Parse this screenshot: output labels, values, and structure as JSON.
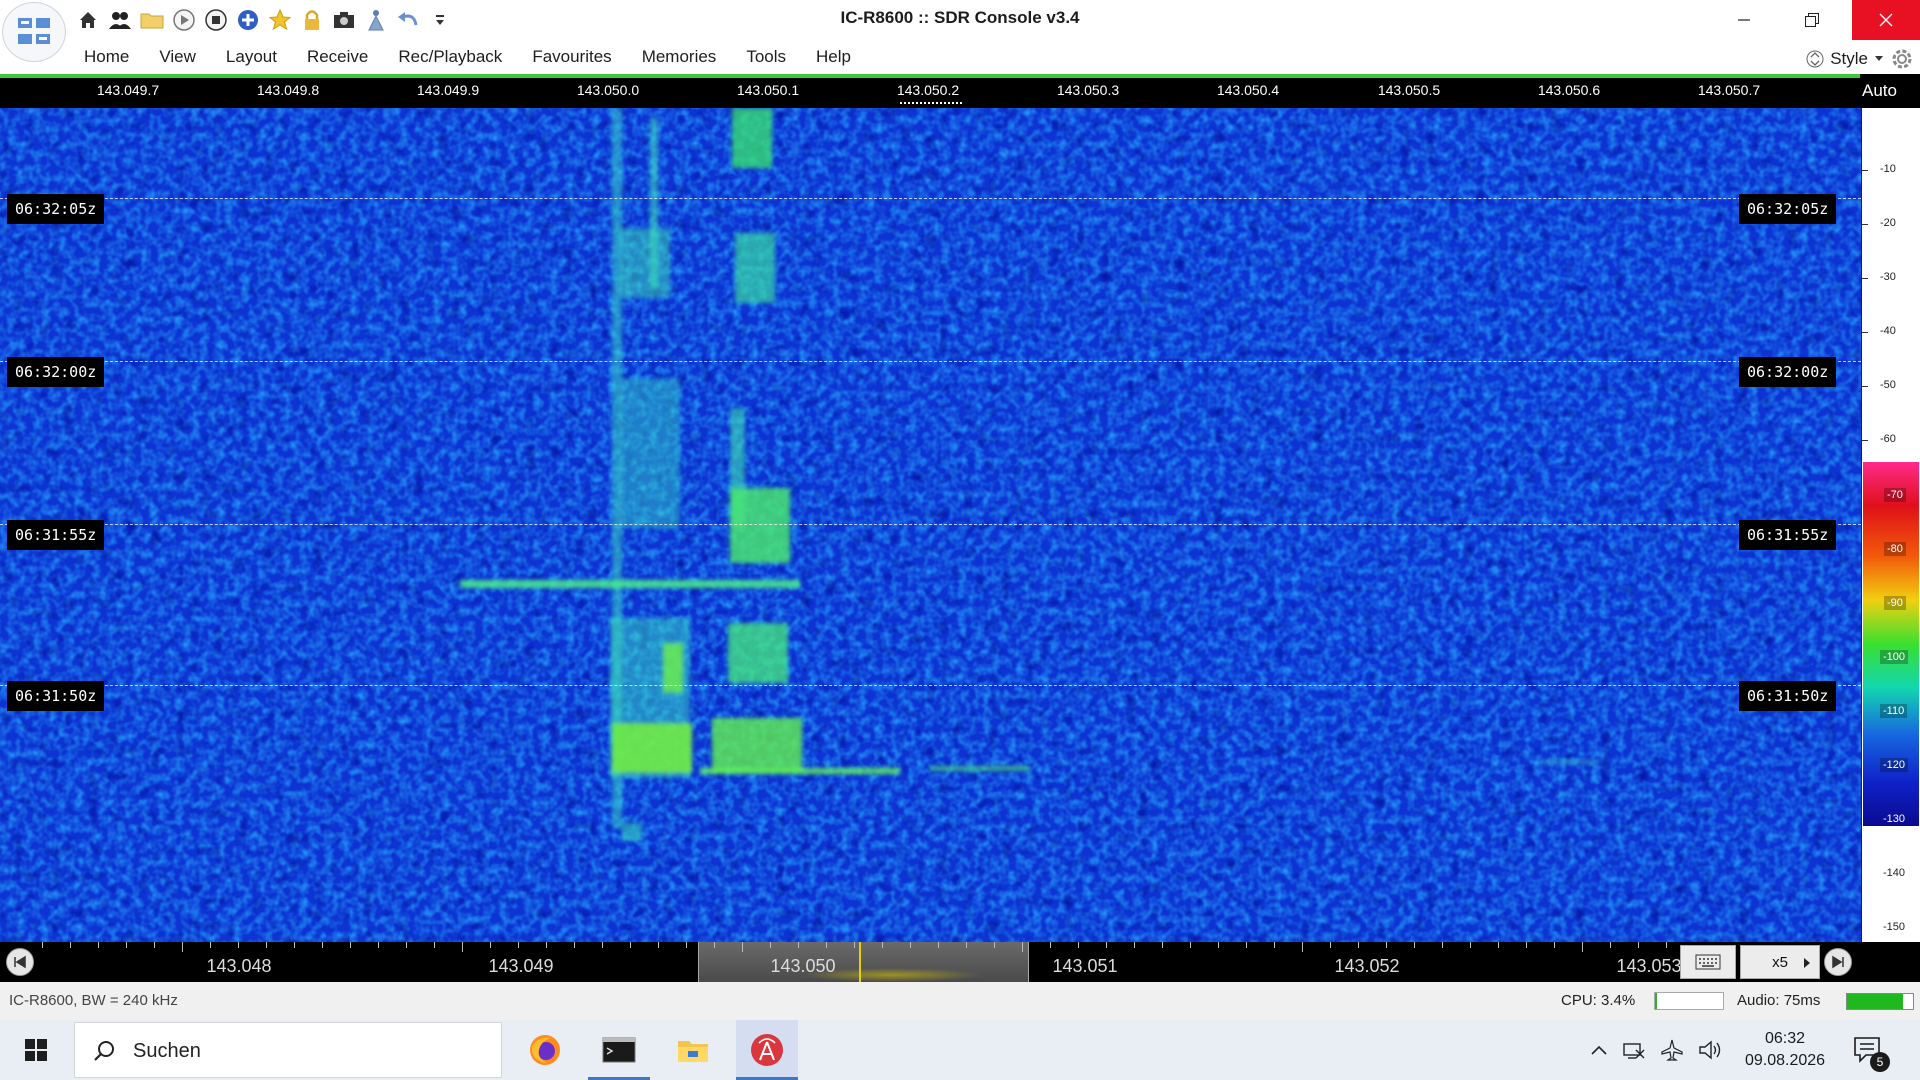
{
  "window": {
    "title": "IC-R8600 :: SDR Console v3.4",
    "controls": [
      "minimize",
      "restore",
      "close"
    ]
  },
  "quick_access_icons": [
    "home-icon",
    "users-icon",
    "folder-icon",
    "play-icon",
    "stop-icon",
    "plus-circle-icon",
    "star-icon",
    "lock-icon",
    "camera-icon",
    "antenna-icon",
    "undo-icon",
    "dropdown-icon"
  ],
  "menu": {
    "items": [
      "Home",
      "View",
      "Layout",
      "Receive",
      "Rec/Playback",
      "Favourites",
      "Memories",
      "Tools",
      "Help"
    ],
    "style_label": "Style"
  },
  "spectrum": {
    "freq_labels": [
      "143.049.7",
      "143.049.8",
      "143.049.9",
      "143.050.0",
      "143.050.1",
      "143.050.2",
      "143.050.3",
      "143.050.4",
      "143.050.5",
      "143.050.6",
      "143.050.7"
    ],
    "auto_label": "Auto"
  },
  "waterfall": {
    "time_labels": [
      "06:32:05z",
      "06:32:00z",
      "06:31:55z",
      "06:31:50z"
    ]
  },
  "level_scale": {
    "ticks": [
      "-10",
      "-20",
      "-30",
      "-40",
      "-50",
      "-60",
      "-70",
      "-80",
      "-90",
      "-100",
      "-110",
      "-120",
      "-130",
      "-140",
      "-150"
    ]
  },
  "ruler": {
    "labels": [
      "143.048",
      "143.049",
      "143.050",
      "143.051",
      "143.052",
      "143.053"
    ],
    "zoom": "x5"
  },
  "status": {
    "device": "IC-R8600, BW = 240 kHz",
    "cpu": "CPU: 3.4%",
    "cpu_level": 0.034,
    "audio": "Audio: 75ms",
    "audio_level": 0.85
  },
  "taskbar": {
    "search_placeholder": "Suchen",
    "apps": [
      "firefox-icon",
      "terminal-icon",
      "file-explorer-icon",
      "sdr-console-icon"
    ],
    "clock_time": "06:32",
    "clock_date": "09.08.2026",
    "notification_count": "5"
  },
  "colors": {
    "waterfall_bg": "#0b2ec9",
    "signal": "#3cf0b4",
    "close_button": "#e81123",
    "accent_line": "#3ec63e"
  }
}
